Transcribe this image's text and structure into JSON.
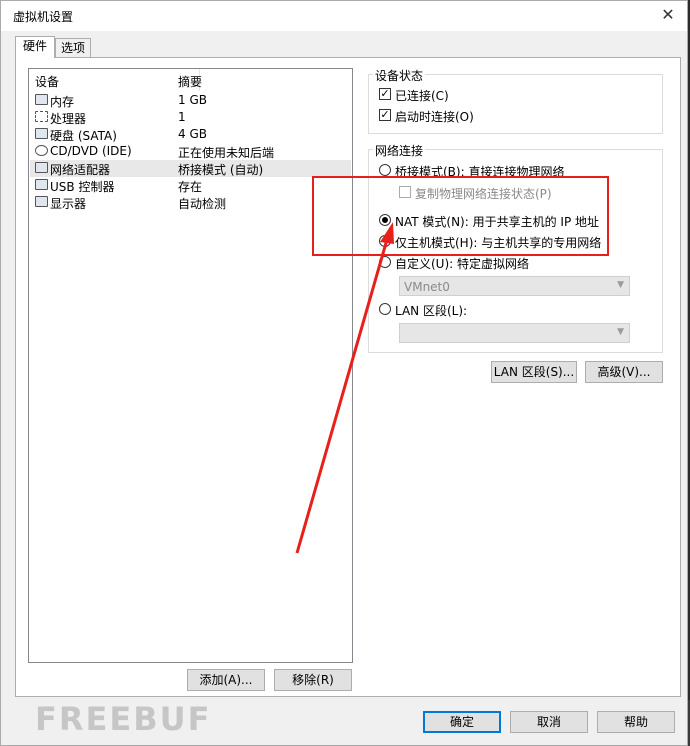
{
  "window": {
    "title": "虚拟机设置",
    "close_glyph": "✕"
  },
  "tabs": [
    {
      "label": "硬件",
      "active": true
    },
    {
      "label": "选项",
      "active": false
    }
  ],
  "device_list": {
    "columns": [
      "设备",
      "摘要"
    ],
    "rows": [
      {
        "icon": "memory-icon",
        "name": "内存",
        "summary": "1 GB",
        "selected": false
      },
      {
        "icon": "processor-icon",
        "name": "处理器",
        "summary": "1",
        "selected": false
      },
      {
        "icon": "hard-disk-icon",
        "name": "硬盘 (SATA)",
        "summary": "4 GB",
        "selected": false
      },
      {
        "icon": "cd-dvd-icon",
        "name": "CD/DVD (IDE)",
        "summary": "正在使用未知后端",
        "selected": false
      },
      {
        "icon": "network-adapter-icon",
        "name": "网络适配器",
        "summary": "桥接模式 (自动)",
        "selected": true
      },
      {
        "icon": "usb-icon",
        "name": "USB 控制器",
        "summary": "存在",
        "selected": false
      },
      {
        "icon": "display-icon",
        "name": "显示器",
        "summary": "自动检测",
        "selected": false
      }
    ]
  },
  "device_status": {
    "label": "设备状态",
    "connected": {
      "label": "已连接(C)",
      "checked": true
    },
    "connect_at_power_on": {
      "label": "启动时连接(O)",
      "checked": true
    }
  },
  "network_connection": {
    "label": "网络连接",
    "bridged": {
      "label": "桥接模式(B): 直接连接物理网络",
      "selected": false
    },
    "replicate": {
      "label": "复制物理网络连接状态(P)",
      "checked": false,
      "enabled": false
    },
    "nat": {
      "label": "NAT 模式(N): 用于共享主机的 IP 地址",
      "selected": true
    },
    "host_only": {
      "label": "仅主机模式(H): 与主机共享的专用网络",
      "selected": false
    },
    "custom": {
      "label": "自定义(U): 特定虚拟网络",
      "selected": false
    },
    "custom_value": "VMnet0",
    "lan_segment": {
      "label": "LAN 区段(L):",
      "selected": false
    },
    "lan_value": ""
  },
  "buttons": {
    "lan_segments": "LAN 区段(S)...",
    "advanced": "高级(V)...",
    "add": "添加(A)...",
    "remove": "移除(R)",
    "ok": "确定",
    "cancel": "取消",
    "help": "帮助"
  },
  "watermark": "FREEBUF",
  "annotation_color": "#e8201c"
}
